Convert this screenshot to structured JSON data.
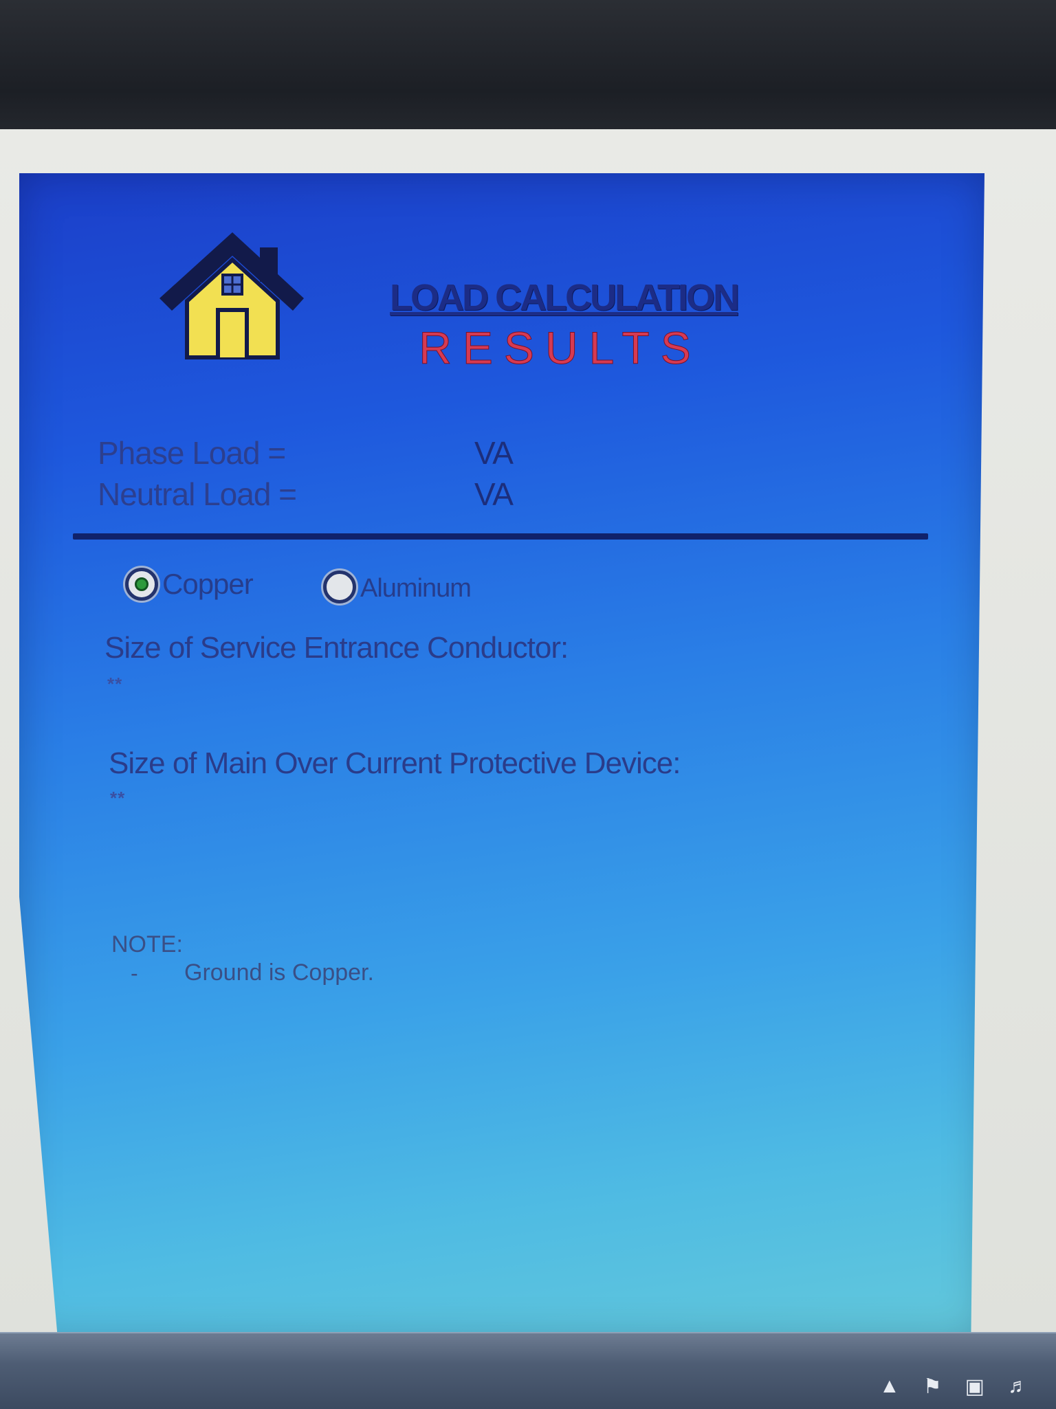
{
  "header": {
    "title": "LOAD CALCULATION",
    "subtitle": "RESULTS"
  },
  "loads": {
    "phase_label": "Phase Load =",
    "phase_unit": "VA",
    "neutral_label": "Neutral Load =",
    "neutral_unit": "VA"
  },
  "material": {
    "options": [
      {
        "label": "Copper",
        "selected": true
      },
      {
        "label": "Aluminum",
        "selected": false
      }
    ]
  },
  "results": {
    "conductor_label": "Size of Service Entrance Conductor:",
    "conductor_value": "**",
    "ocpd_label": "Size of Main Over Current Protective Device:",
    "ocpd_value": "**"
  },
  "note": {
    "title": "NOTE:",
    "bullet": "-",
    "text": "Ground is Copper."
  },
  "icons": {
    "app": "house-icon",
    "tray": [
      "up-arrow-icon",
      "flag-icon",
      "network-icon",
      "speaker-icon"
    ]
  },
  "colors": {
    "panel_top": "#1b3fc9",
    "panel_bottom": "#63c8db",
    "title": "#1c2c86",
    "subtitle": "#d63a52",
    "radio_selected": "#2e9a3c"
  }
}
